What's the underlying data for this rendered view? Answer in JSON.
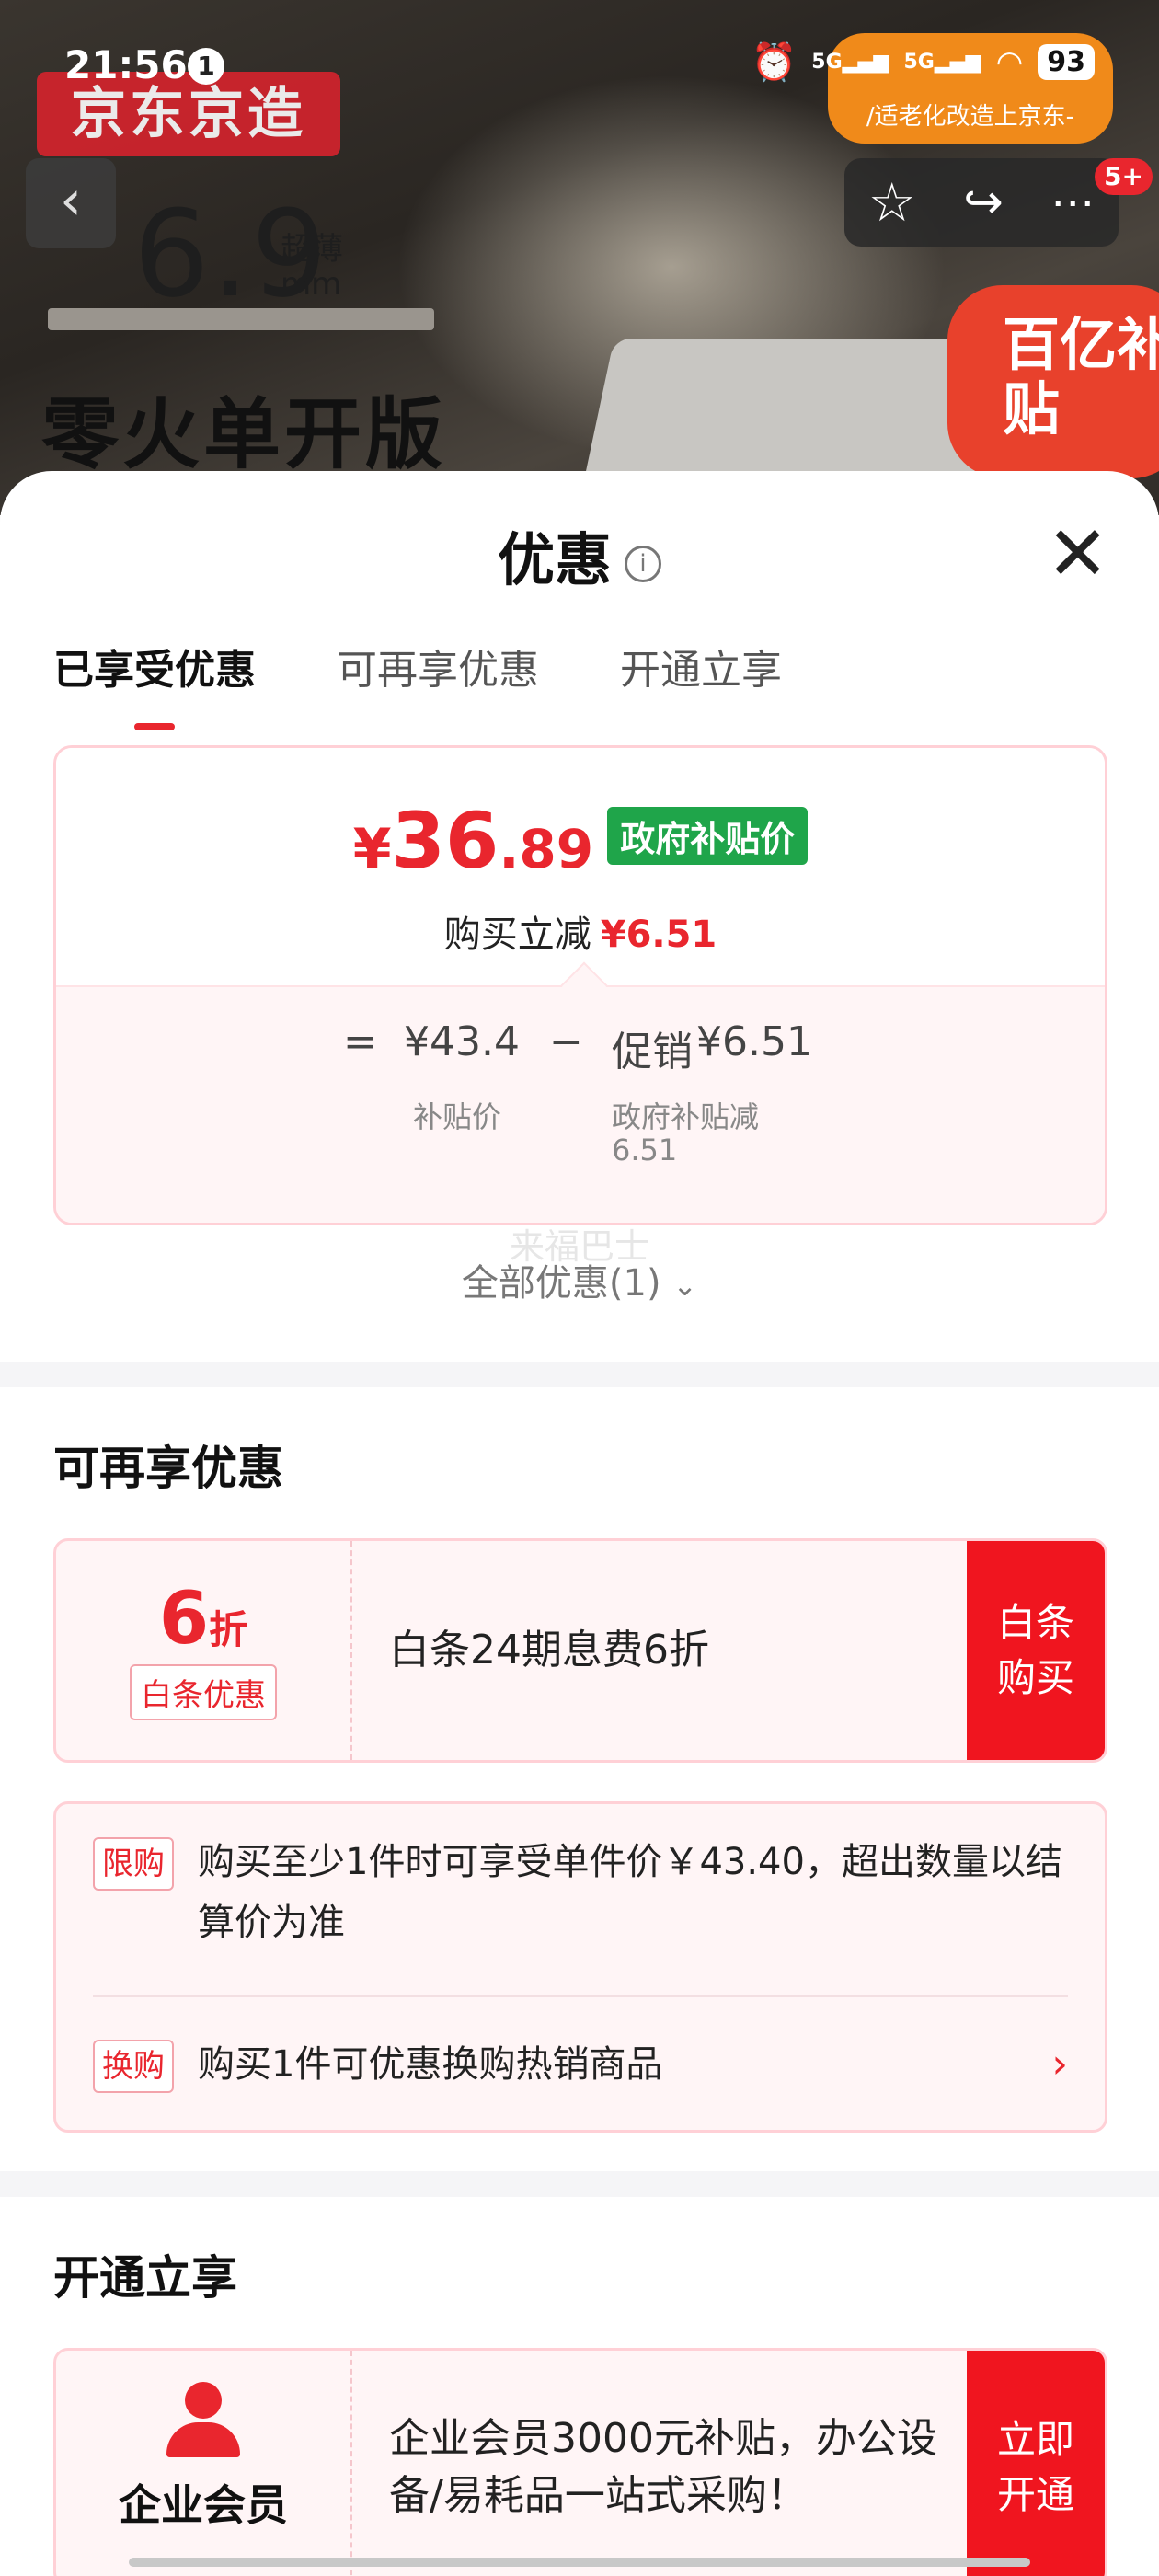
{
  "status_bar": {
    "time": "21:56",
    "notification_count": "1",
    "signal_1": "5G",
    "signal_2": "5G",
    "battery": "93"
  },
  "hero": {
    "brand": "京东京造",
    "thickness": "6.9",
    "thickness_label": "超薄",
    "thickness_unit": "mm",
    "edition": "零火单开版",
    "promo_badge_sub": "/适老化改造上京东-",
    "subsidy_badge": "百亿补贴"
  },
  "nav": {
    "back": "‹",
    "more_badge": "5+"
  },
  "sheet": {
    "title": "优惠",
    "info_icon": "i",
    "tabs": [
      "已享受优惠",
      "可再享优惠",
      "开通立享"
    ],
    "price": {
      "currency": "¥",
      "integer": "36",
      "decimal": ".89",
      "tag": "政府补贴价",
      "reduce_label": "购买立减",
      "reduce_value": "¥6.51",
      "equals": "=",
      "base_price": "¥43.4",
      "minus": "−",
      "promo": "促销",
      "promo_value": "¥6.51",
      "base_label": "补贴价",
      "promo_label_line1": "政府补贴减",
      "promo_label_line2": "6.51"
    },
    "ghost_text": "来福巴士",
    "all_offers": "全部优惠(1)",
    "more_section": {
      "title": "可再享优惠",
      "coupon": {
        "discount": "6",
        "unit": "折",
        "tag": "白条优惠",
        "desc": "白条24期息费6折",
        "button_line1": "白条",
        "button_line2": "购买"
      },
      "limits": [
        {
          "tag": "限购",
          "text": "购买至少1件时可享受单件价￥43.40，超出数量以结算价为准"
        },
        {
          "tag": "换购",
          "text": "购买1件可优惠换购热销商品"
        }
      ]
    },
    "open_section": {
      "title": "开通立享",
      "member": {
        "label": "企业会员",
        "desc": "企业会员3000元补贴，办公设备/易耗品一站式采购！",
        "button_line1": "立即",
        "button_line2": "开通"
      }
    }
  },
  "colors": {
    "accent": "#e9262e",
    "green_tag": "#1fa54a",
    "card_border": "#ffd0d6"
  }
}
